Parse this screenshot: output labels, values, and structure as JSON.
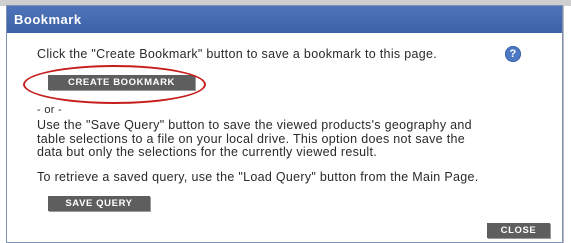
{
  "dialog": {
    "title": "Bookmark",
    "instruction": "Click the \"Create Bookmark\" button to save a bookmark to this page.",
    "help_icon": "question-circle-icon",
    "create_button_label": "CREATE BOOKMARK",
    "or_text": "- or -",
    "save_query_lines": [
      "Use the \"Save Query\" button to save the viewed products's geography and",
      "table selections to a file on your local drive. This option does not save the",
      "data but only the selections for the currently viewed result."
    ],
    "load_query_text": "To retrieve a saved query, use the \"Load Query\" button from the Main Page.",
    "save_query_button_label": "SAVE QUERY",
    "close_button_label": "CLOSE"
  },
  "colors": {
    "title_bar": "#4a6fb5",
    "button": "#5e5e5e",
    "highlight_oval": "#c61d1d",
    "help_icon": "#4d79c4"
  }
}
